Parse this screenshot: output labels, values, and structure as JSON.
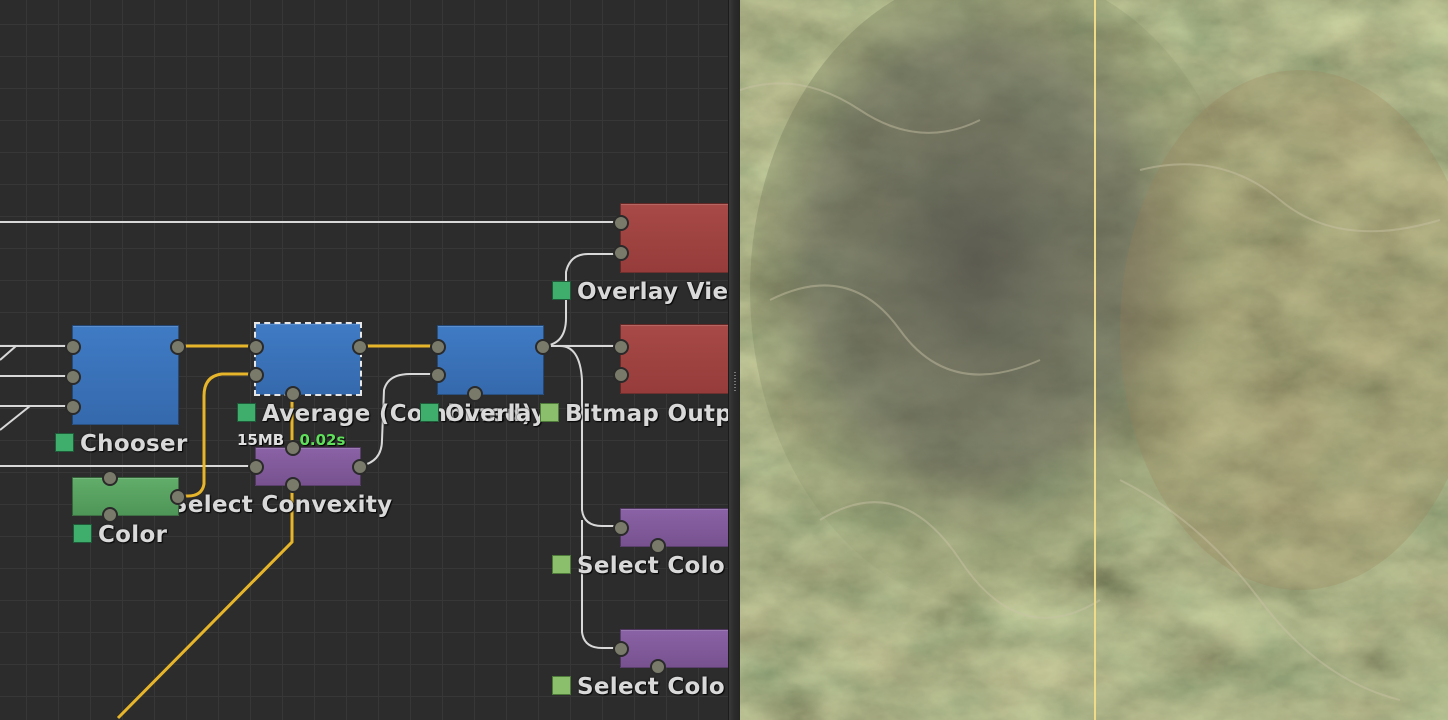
{
  "graph": {
    "nodes": [
      {
        "id": "chooser",
        "label": "Chooser"
      },
      {
        "id": "average",
        "label": "Average (Combined)",
        "mem": "15MB",
        "time": "0.02s"
      },
      {
        "id": "overlay",
        "label": "Overlay"
      },
      {
        "id": "overlay_view",
        "label": "Overlay Vie"
      },
      {
        "id": "bitmap_output",
        "label": "Bitmap Outp"
      },
      {
        "id": "select_convexity",
        "label": "Select Convexity"
      },
      {
        "id": "color",
        "label": "Color"
      },
      {
        "id": "select_color_1",
        "label": "Select Colo"
      },
      {
        "id": "select_color_2",
        "label": "Select Colo"
      }
    ]
  },
  "colors": {
    "wire": "#d8d8d8",
    "wire_active": "#e7b52a",
    "status_green": "#3fae6c",
    "status_light": "#8bbf6c",
    "time_text": "#5fe05a"
  },
  "viewer": {
    "split_line_color": "#f0dc88"
  }
}
